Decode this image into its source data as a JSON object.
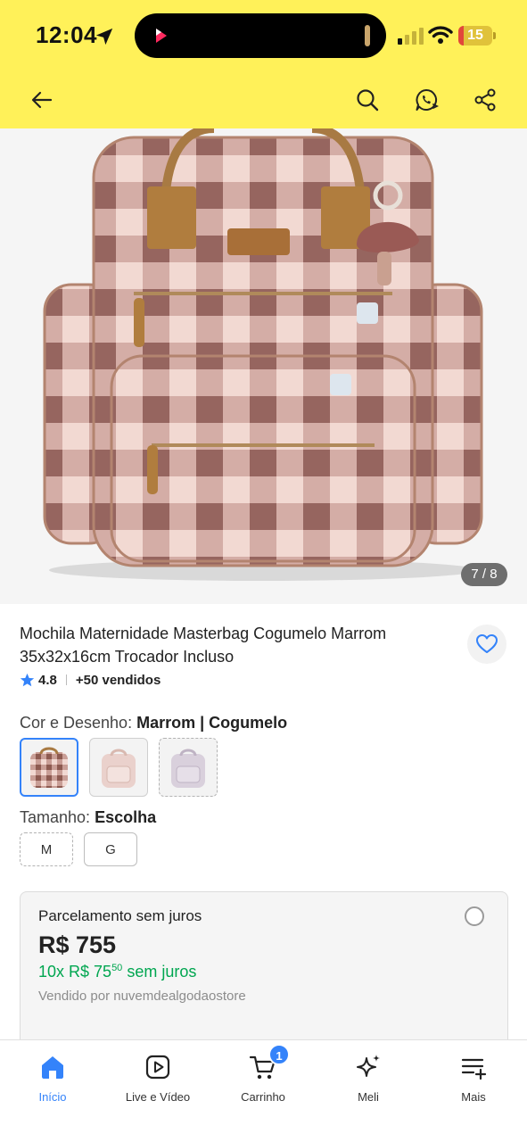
{
  "status_bar": {
    "time": "12:04",
    "battery": "15",
    "battery_level": 0.15
  },
  "header": {
    "background": "#fff159",
    "back_icon": "arrow-left-icon",
    "search_icon": "search-icon",
    "whatsapp_icon": "whatsapp-icon",
    "share_icon": "share-icon"
  },
  "gallery": {
    "counter": "7 / 8"
  },
  "product": {
    "title": "Mochila Maternidade Masterbag Cogumelo Marrom 35x32x16cm Trocador Incluso",
    "rating": "4.8",
    "sold": "+50 vendidos"
  },
  "variants": {
    "color_label": "Cor e Desenho:",
    "color_value": "Marrom | Cogumelo",
    "size_label": "Tamanho:",
    "size_value": "Escolha",
    "sizes": [
      "M",
      "G"
    ]
  },
  "payment": {
    "title": "Parcelamento sem juros",
    "price": "R$ 755",
    "installments_prefix": "10x R$ 75",
    "installments_cents": "50",
    "installments_suffix": " sem juros",
    "seller": "Vendido por nuvemdealgodaostore",
    "accent_green": "#00a650"
  },
  "tabbar": {
    "accent": "#3483fa",
    "cart_badge": "1",
    "tabs": [
      {
        "label": "Início",
        "icon": "home-icon"
      },
      {
        "label": "Live e Vídeo",
        "icon": "play-icon"
      },
      {
        "label": "Carrinho",
        "icon": "cart-icon"
      },
      {
        "label": "Meli",
        "icon": "sparkle-icon"
      },
      {
        "label": "Mais",
        "icon": "menu-plus-icon"
      }
    ]
  }
}
